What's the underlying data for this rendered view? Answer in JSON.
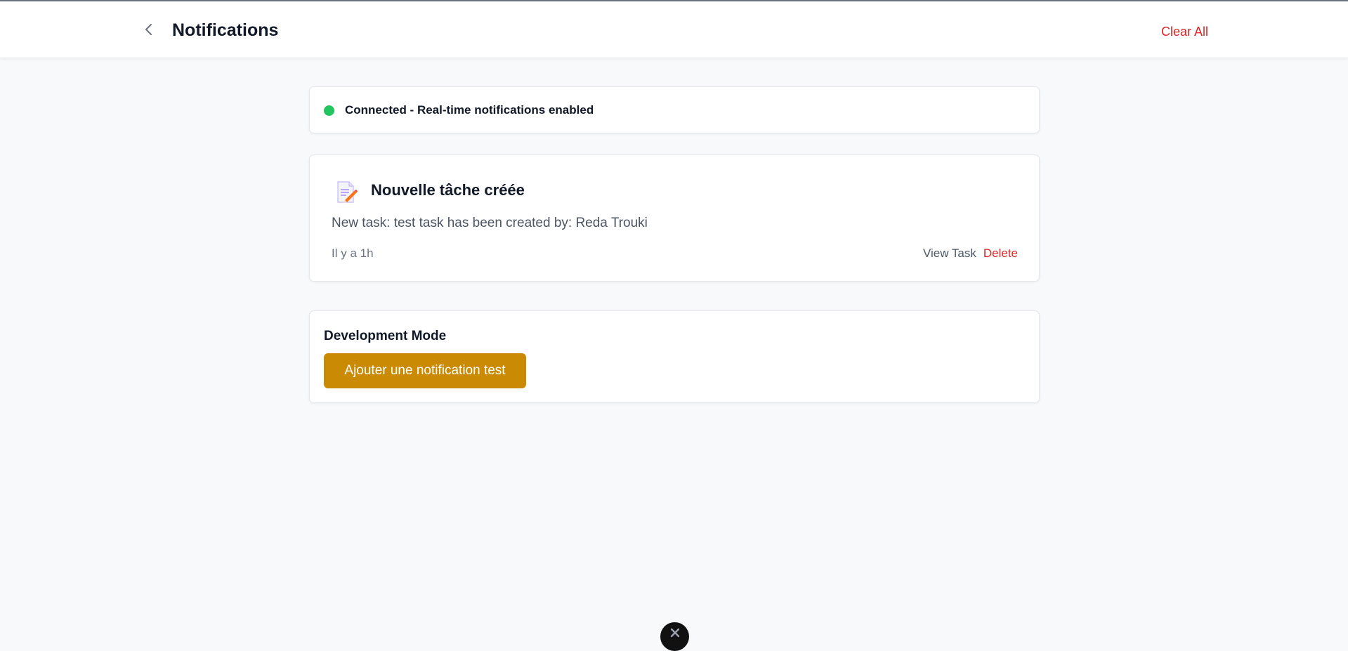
{
  "header": {
    "title": "Notifications",
    "back_icon": "chevron-left-icon",
    "clear_all_label": "Clear All"
  },
  "connection": {
    "status_text": "Connected - Real-time notifications enabled",
    "status_color": "#22c55e"
  },
  "notifications": [
    {
      "icon": "memo-icon",
      "title": "Nouvelle tâche créée",
      "message": "New task: test task has been created by: Reda Trouki",
      "time": "Il y a 1h",
      "view_label": "View Task",
      "delete_label": "Delete"
    }
  ],
  "dev_mode": {
    "title": "Development Mode",
    "button_label": "Ajouter une notification test",
    "button_color": "#ca8a04"
  },
  "colors": {
    "danger": "#dc2626",
    "background": "#f8f9fb"
  },
  "bottom_badge": {
    "icon": "close-icon"
  }
}
